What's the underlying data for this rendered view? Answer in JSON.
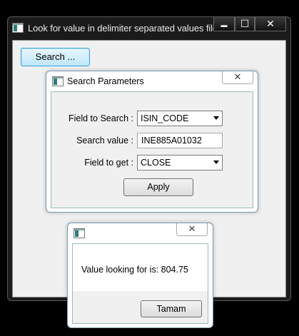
{
  "main_window": {
    "title": "Look for value in delimiter separated values file",
    "minimize_glyph": "▬",
    "maximize_glyph": "☐",
    "close_glyph": "✕",
    "search_button_label": "Search ..."
  },
  "search_dialog": {
    "title": "Search Parameters",
    "close_glyph": "✕",
    "field_to_search_label": "Field to Search :",
    "field_to_search_value": "ISIN_CODE",
    "search_value_label": "Search value :",
    "search_value": "INE885A01032",
    "field_to_get_label": "Field to get :",
    "field_to_get_value": "CLOSE",
    "apply_label": "Apply"
  },
  "message_box": {
    "title": "",
    "close_glyph": "✕",
    "message": "Value looking for is: 804.75",
    "ok_label": "Tamam"
  },
  "colors": {
    "accent": "#3c9fd8",
    "window_frame": "#1b1b1b",
    "client_bg": "#f0f0f0"
  }
}
